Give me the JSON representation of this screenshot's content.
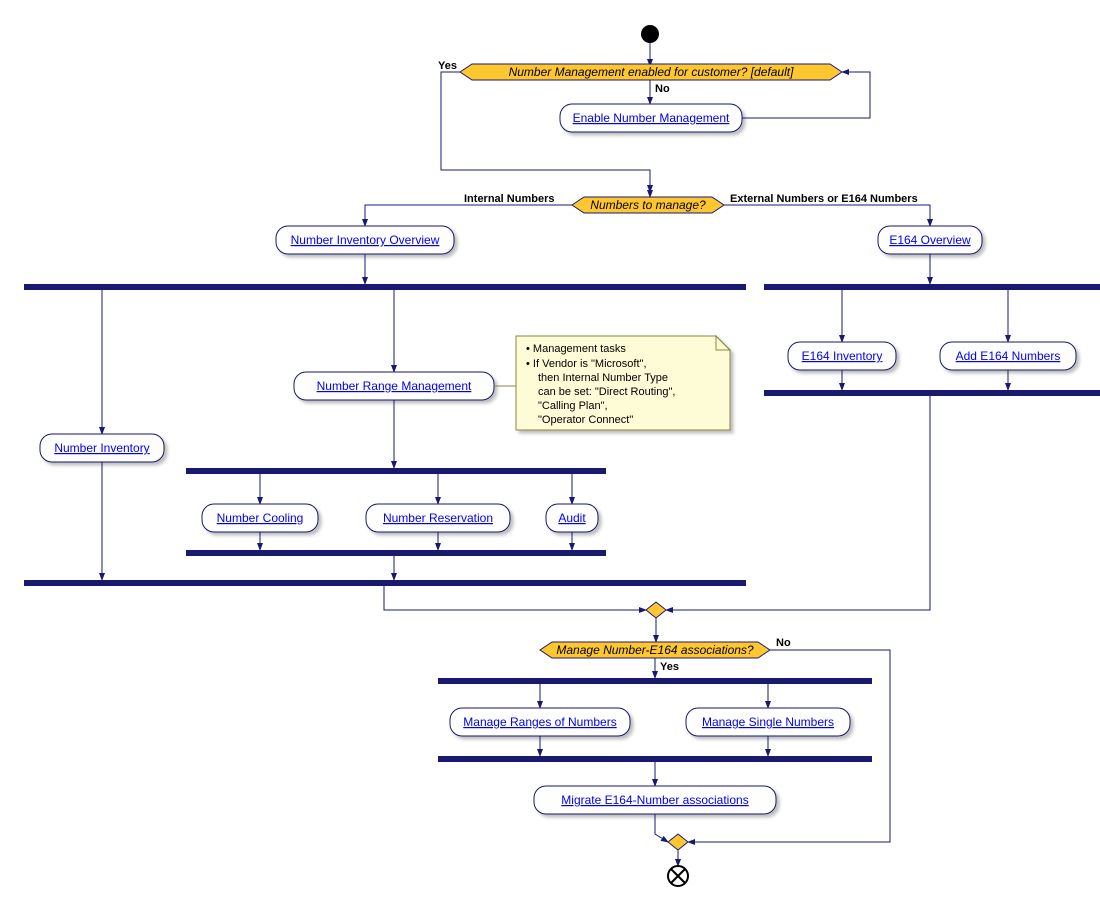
{
  "decisions": {
    "d1": "Number Management enabled for customer? [default]",
    "d1_yes": "Yes",
    "d1_no": "No",
    "d2": "Numbers to manage?",
    "d2_left": "Internal Numbers",
    "d2_right": "External Numbers or E164 Numbers",
    "d3": "Manage Number-E164 associations?",
    "d3_yes": "Yes",
    "d3_no": "No"
  },
  "activities": {
    "enable_nm": "Enable Number Management",
    "num_inv_overview": "Number Inventory Overview",
    "e164_overview": "E164 Overview",
    "e164_inventory": "E164 Inventory",
    "add_e164": "Add E164 Numbers",
    "number_range_mgmt": "Number Range Management",
    "number_inventory": "Number Inventory",
    "number_cooling": "Number Cooling",
    "number_reservation": "Number Reservation",
    "audit": "Audit",
    "manage_ranges": "Manage Ranges of Numbers",
    "manage_single": "Manage Single Numbers",
    "migrate_e164": "Migrate E164-Number associations"
  },
  "note": {
    "line1": "Management tasks",
    "line2a": "If Vendor is \"Microsoft\",",
    "line2b": "then Internal Number Type",
    "line2c": "can be set: \"Direct Routing\",",
    "line2d": "\"Calling Plan\",",
    "line2e": "\"Operator Connect\""
  }
}
